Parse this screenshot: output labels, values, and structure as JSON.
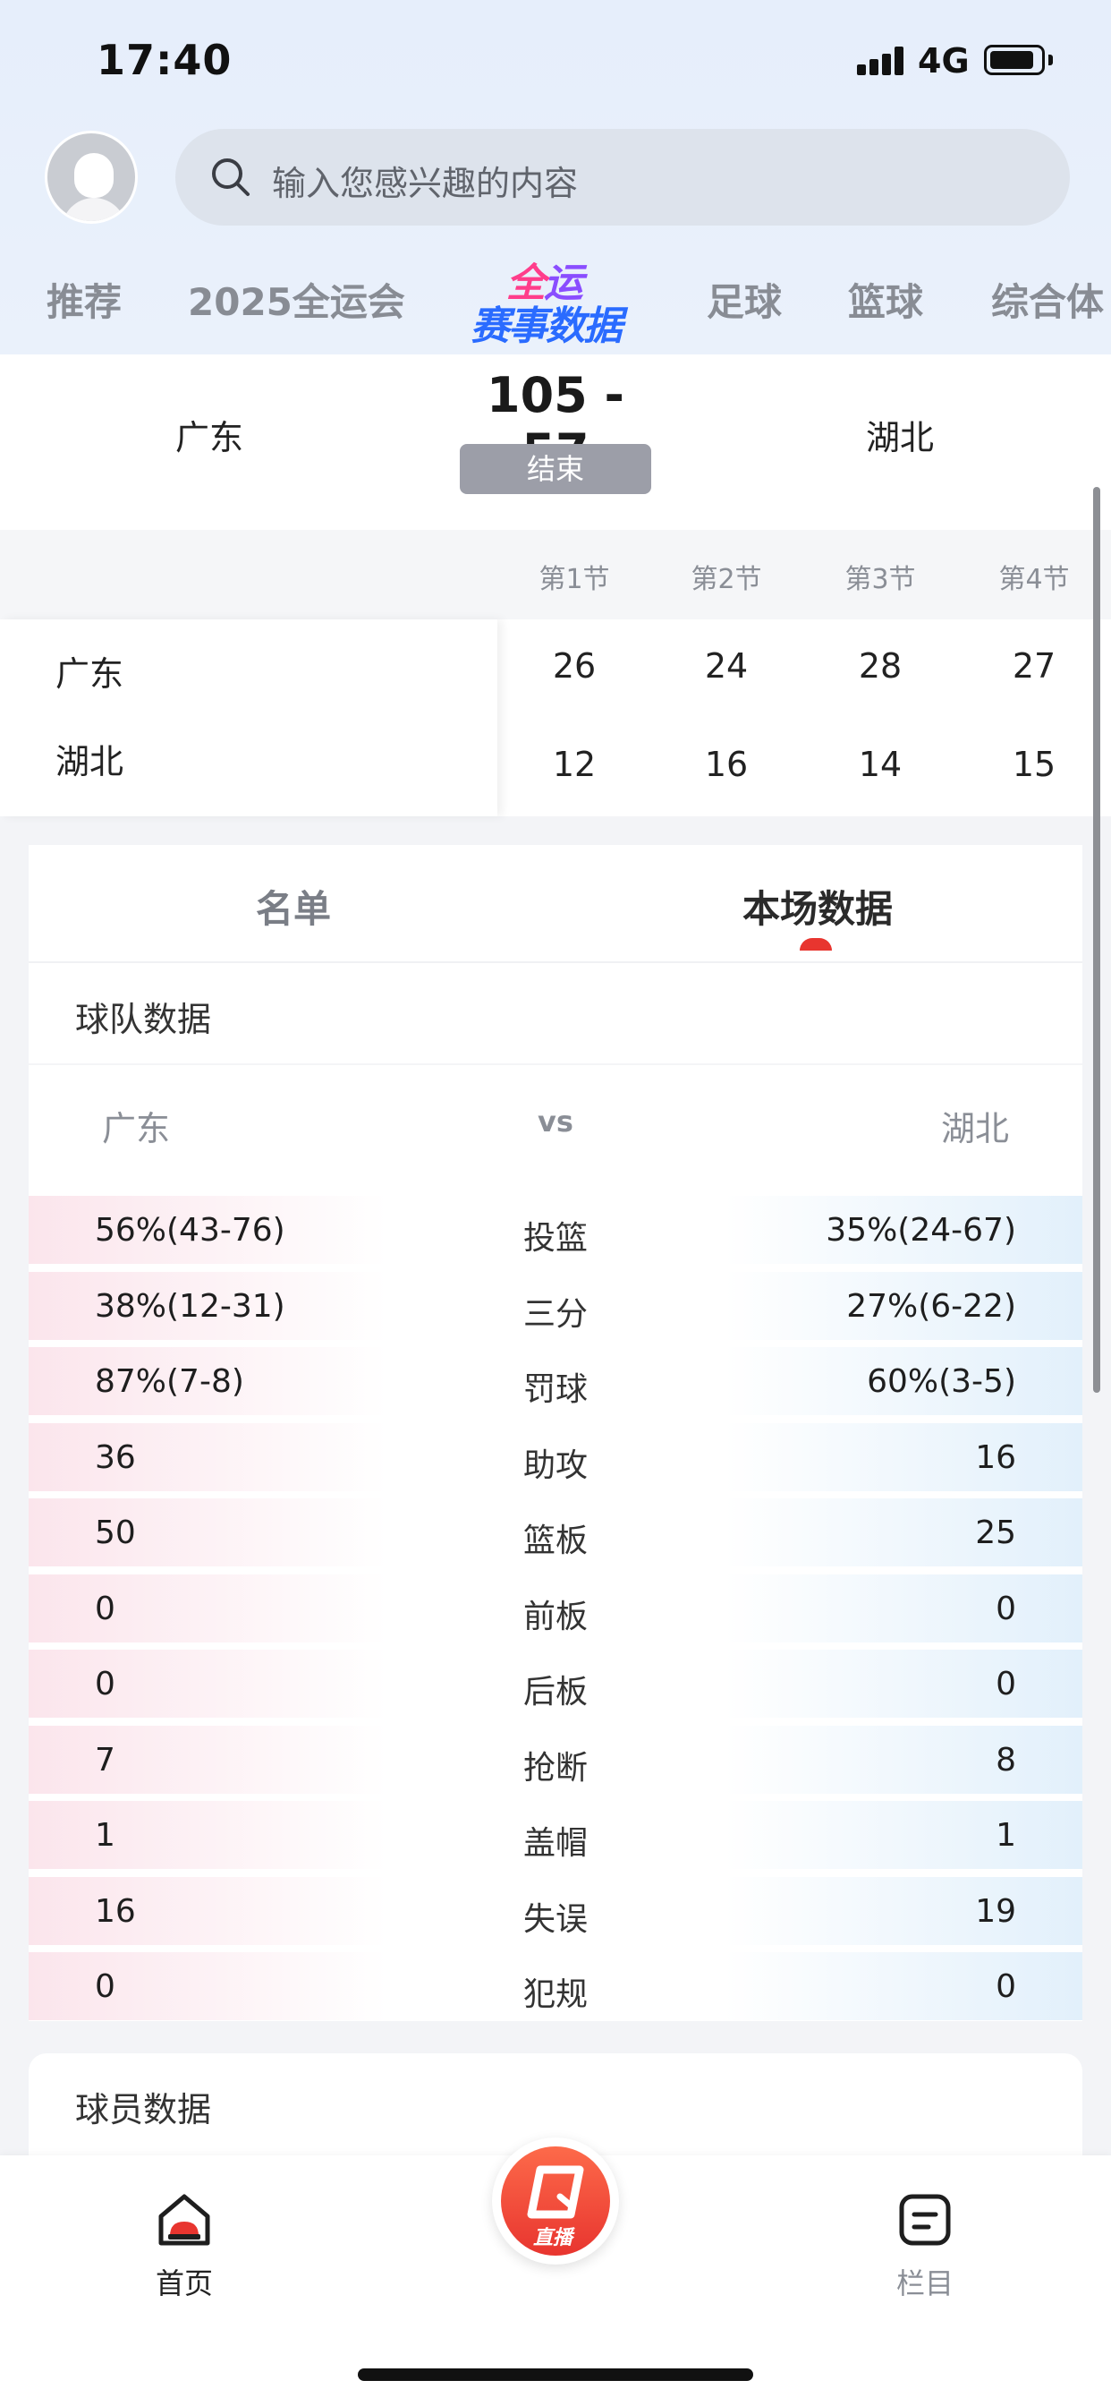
{
  "status_bar": {
    "time": "17:40",
    "network": "4G"
  },
  "search": {
    "placeholder": "输入您感兴趣的内容"
  },
  "category_tabs": {
    "items": [
      "推荐",
      "2025全运会",
      "足球",
      "篮球",
      "综合体"
    ],
    "logo_line1a": "全",
    "logo_line1b": "运",
    "logo_line2": "赛事数据"
  },
  "match": {
    "home": "广东",
    "away": "湖北",
    "score": "105 - 57",
    "status": "结束"
  },
  "quarters": {
    "headers": [
      "第1节",
      "第2节",
      "第3节",
      "第4节"
    ],
    "rows": [
      {
        "team": "广东",
        "scores": [
          "26",
          "24",
          "28",
          "27"
        ]
      },
      {
        "team": "湖北",
        "scores": [
          "12",
          "16",
          "14",
          "15"
        ]
      }
    ]
  },
  "tabs": {
    "roster": "名单",
    "stats": "本场数据"
  },
  "team_stats": {
    "title": "球队数据",
    "home": "广东",
    "vs": "vs",
    "away": "湖北",
    "rows": [
      {
        "label": "投篮",
        "home": "56%(43-76)",
        "away": "35%(24-67)"
      },
      {
        "label": "三分",
        "home": "38%(12-31)",
        "away": "27%(6-22)"
      },
      {
        "label": "罚球",
        "home": "87%(7-8)",
        "away": "60%(3-5)"
      },
      {
        "label": "助攻",
        "home": "36",
        "away": "16"
      },
      {
        "label": "篮板",
        "home": "50",
        "away": "25"
      },
      {
        "label": "前板",
        "home": "0",
        "away": "0"
      },
      {
        "label": "后板",
        "home": "0",
        "away": "0"
      },
      {
        "label": "抢断",
        "home": "7",
        "away": "8"
      },
      {
        "label": "盖帽",
        "home": "1",
        "away": "1"
      },
      {
        "label": "失误",
        "home": "16",
        "away": "19"
      },
      {
        "label": "犯规",
        "home": "0",
        "away": "0"
      }
    ]
  },
  "player_stats": {
    "title": "球员数据"
  },
  "bottom_nav": {
    "home": "首页",
    "live": "直播",
    "columns": "栏目"
  },
  "colors": {
    "accent_red": "#e8352f",
    "home_tint": "#fbe5ec",
    "away_tint": "#e2f0fb"
  }
}
